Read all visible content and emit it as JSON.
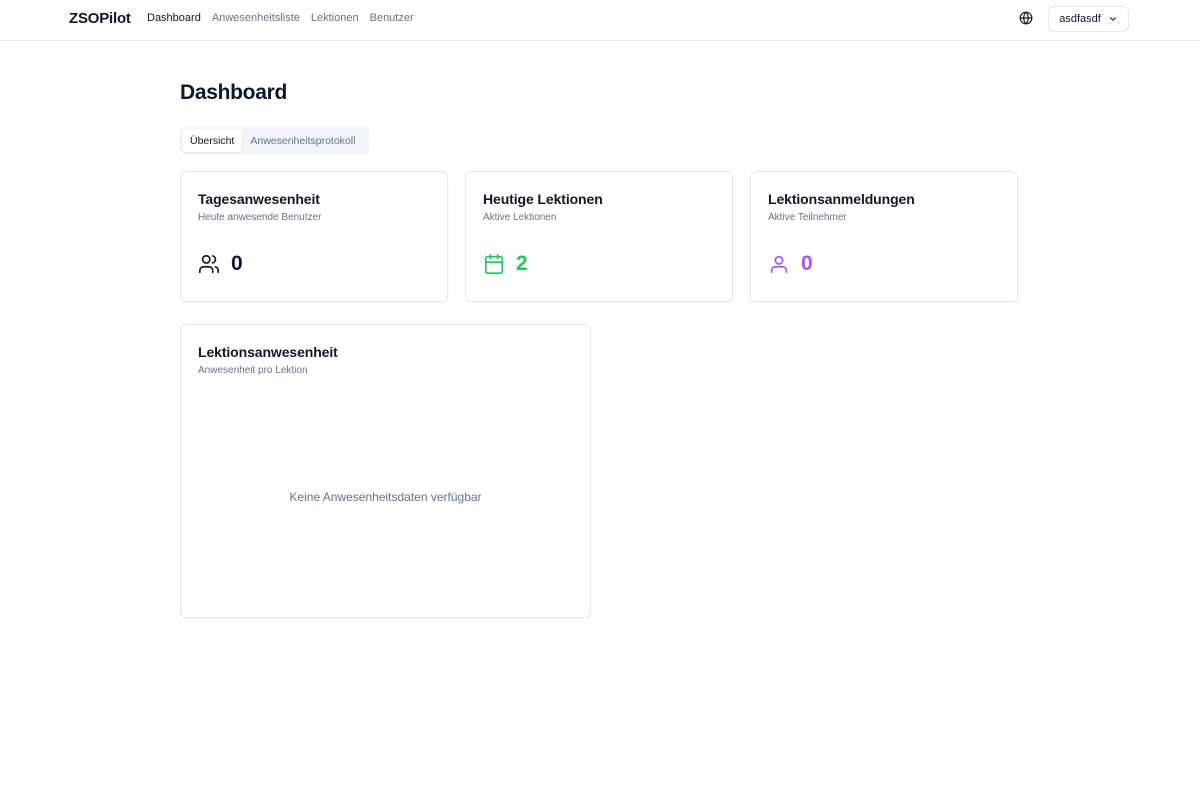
{
  "header": {
    "brand": "ZSOPilot",
    "nav": [
      "Dashboard",
      "Anwesenheitsliste",
      "Lektionen",
      "Benutzer"
    ],
    "active_nav": "Dashboard",
    "user_label": "asdfasdf",
    "icons": {
      "language": "globe-icon",
      "user_menu": "chevron-down-icon"
    }
  },
  "page": {
    "title": "Dashboard",
    "tabs": [
      "Übersicht",
      "Anwesenheitsprotokoll"
    ],
    "active_tab": "Übersicht"
  },
  "stats": [
    {
      "title": "Tagesanwesenheit",
      "subtitle": "Heute anwesende Benutzer",
      "value": "0",
      "icon": "users-icon",
      "color": "#0f172a"
    },
    {
      "title": "Heutige Lektionen",
      "subtitle": "Aktive Lektionen",
      "value": "2",
      "icon": "calendar-icon",
      "color": "#22c55e"
    },
    {
      "title": "Lektionsanmeldungen",
      "subtitle": "Aktive Teilnehmer",
      "value": "0",
      "icon": "user-icon",
      "color": "#a855f7"
    }
  ],
  "attendance_card": {
    "title": "Lektionsanwesenheit",
    "subtitle": "Anwesenheit pro Lektion",
    "empty_message": "Keine Anwesenheitsdaten verfügbar"
  },
  "colors": {
    "border": "#e5e7eb",
    "muted": "#64748b",
    "text": "#0f172a",
    "green": "#22c55e",
    "purple": "#a855f7"
  }
}
